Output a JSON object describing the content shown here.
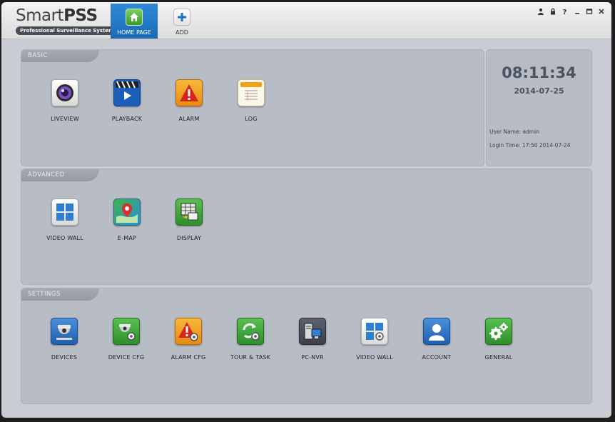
{
  "app": {
    "logo_main": "Smart",
    "logo_bold": "PSS",
    "logo_sub": "Professional Surveillance System"
  },
  "tabs": [
    {
      "label": "HOME PAGE",
      "icon": "home-icon"
    },
    {
      "label": "ADD",
      "icon": "plus-icon"
    }
  ],
  "window_controls": [
    "user-icon",
    "lock-icon",
    "help-icon",
    "minimize-icon",
    "maximize-icon",
    "close-icon"
  ],
  "sections": {
    "basic": {
      "title": "BASIC",
      "items": [
        {
          "label": "LIVEVIEW",
          "icon": "camera-lens-icon"
        },
        {
          "label": "PLAYBACK",
          "icon": "clapper-play-icon"
        },
        {
          "label": "ALARM",
          "icon": "warning-icon"
        },
        {
          "label": "LOG",
          "icon": "log-notepad-icon"
        }
      ]
    },
    "advanced": {
      "title": "ADVANCED",
      "items": [
        {
          "label": "VIDEO WALL",
          "icon": "grid-icon"
        },
        {
          "label": "E-MAP",
          "icon": "map-pin-icon"
        },
        {
          "label": "DISPLAY",
          "icon": "display-icon"
        }
      ]
    },
    "settings": {
      "title": "SETTINGS",
      "items": [
        {
          "label": "DEVICES",
          "icon": "dome-camera-icon"
        },
        {
          "label": "DEVICE CFG",
          "icon": "device-config-icon"
        },
        {
          "label": "ALARM CFG",
          "icon": "alarm-config-icon"
        },
        {
          "label": "TOUR & TASK",
          "icon": "tour-task-icon"
        },
        {
          "label": "PC-NVR",
          "icon": "pc-nvr-icon"
        },
        {
          "label": "VIDEO WALL",
          "icon": "video-wall-config-icon"
        },
        {
          "label": "ACCOUNT",
          "icon": "account-icon"
        },
        {
          "label": "GENERAL",
          "icon": "gears-icon"
        }
      ]
    }
  },
  "clock": {
    "time": "08:11:34",
    "date": "2014-07-25",
    "user_name": "User Name: admin",
    "login_time": "Login Time: 17:50 2014-07-24"
  },
  "colors": {
    "accent": "#1f74c2",
    "panel": "#b7bcc5",
    "background": "#c9cdd3"
  }
}
